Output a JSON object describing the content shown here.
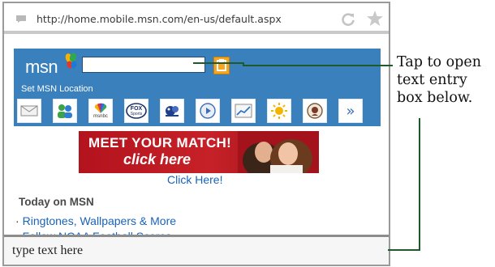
{
  "browser": {
    "url": "http://home.mobile.msn.com/en-us/default.aspx",
    "icons": [
      "page-icon",
      "refresh-icon",
      "star-icon"
    ]
  },
  "msn": {
    "logo": "msn",
    "search_value": "",
    "set_location": "Set MSN Location",
    "icon_tiles": [
      "mail-icon",
      "people-icon",
      "msnbc-icon",
      "fox-sports-icon",
      "game-icon",
      "video-icon",
      "money-icon",
      "weather-icon",
      "horoscope-icon",
      "more-chevron-icon"
    ],
    "msnbc_label": "msnbc",
    "fox_label": "FOX",
    "fox_sub": "Sports",
    "more_glyph": "»"
  },
  "banner": {
    "line1": "MEET YOUR MATCH!",
    "line2": "click here"
  },
  "click_here": "Click Here!",
  "today": {
    "heading": "Today on MSN",
    "links": [
      "Ringtones, Wallpapers & More",
      "Follow NCAA Football Scores"
    ]
  },
  "text_entry": {
    "value": "type text here"
  },
  "callout": {
    "text": "Tap to open text entry box below."
  },
  "colors": {
    "msn_blue": "#3a80bd",
    "link_blue": "#1a63b8",
    "banner_red": "#c72128",
    "callout_green": "#1f5a2b",
    "search_orange": "#f5a623"
  }
}
